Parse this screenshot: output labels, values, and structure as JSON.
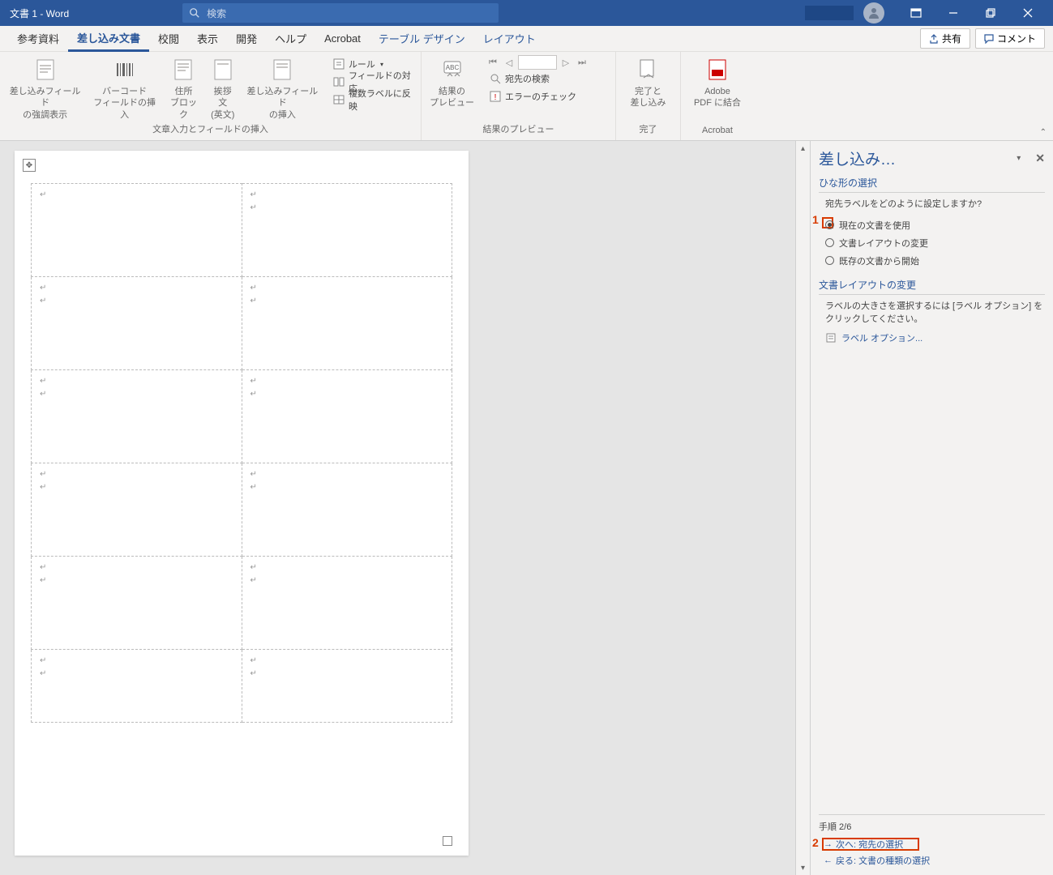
{
  "titlebar": {
    "title": "文書 1  -  Word",
    "search_placeholder": "検索"
  },
  "tabs": {
    "items": [
      "参考資料",
      "差し込み文書",
      "校閲",
      "表示",
      "開発",
      "ヘルプ",
      "Acrobat",
      "テーブル デザイン",
      "レイアウト"
    ],
    "active_index": 1,
    "share": "共有",
    "comment": "コメント"
  },
  "ribbon": {
    "g1": {
      "highlight": "差し込みフィールド\nの強調表示",
      "barcode": "バーコード\nフィールドの挿入",
      "address": "住所\nブロック",
      "greeting": "挨拶文\n (英文)",
      "insert_field": "差し込みフィールド\nの挿入",
      "rules": "ルール",
      "match": "フィールドの対応",
      "update": "複数ラベルに反映",
      "label": "文章入力とフィールドの挿入"
    },
    "g2": {
      "preview": "結果の\nプレビュー",
      "find": "宛先の検索",
      "errors": "エラーのチェック",
      "label": "結果のプレビュー"
    },
    "g3": {
      "finish": "完了と\n差し込み",
      "label": "完了"
    },
    "g4": {
      "pdf": "Adobe\nPDF に結合",
      "label": "Acrobat"
    }
  },
  "taskpane": {
    "title": "差し込み…",
    "sec1_title": "ひな形の選択",
    "sec1_q": "宛先ラベルをどのように設定しますか?",
    "radios": [
      "現在の文書を使用",
      "文書レイアウトの変更",
      "既存の文書から開始"
    ],
    "radio_selected": 0,
    "sec2_title": "文書レイアウトの変更",
    "sec2_text": "ラベルの大きさを選択するには [ラベル オプション] をクリックしてください。",
    "label_options": "ラベル オプション...",
    "step": "手順 2/6",
    "next": "次へ: 宛先の選択",
    "back": "戻る: 文書の種類の選択"
  },
  "annotations": {
    "one": "1",
    "two": "2"
  }
}
